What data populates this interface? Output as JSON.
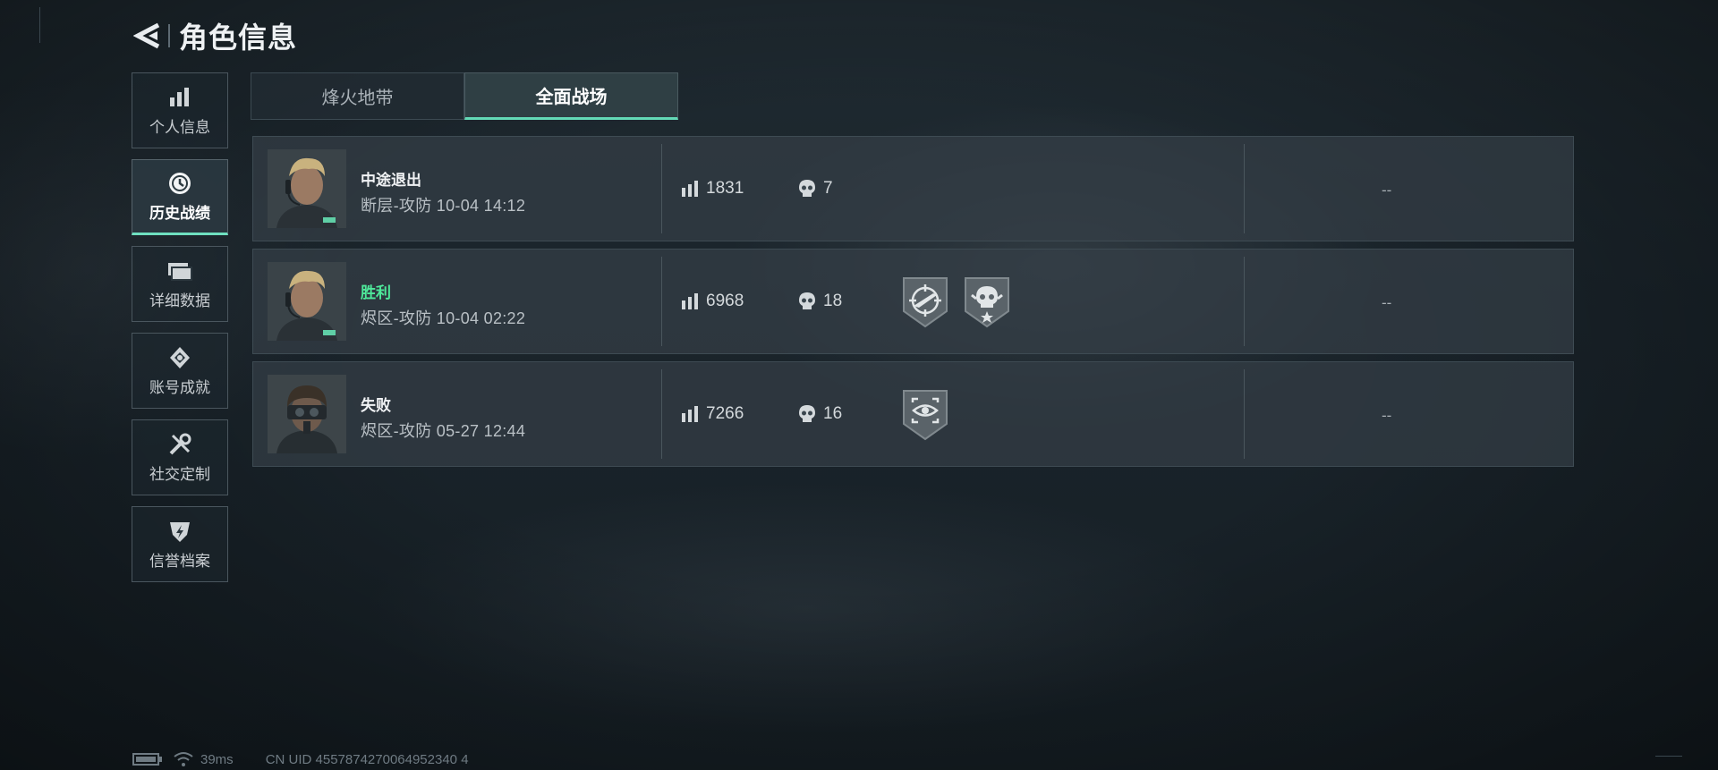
{
  "header": {
    "title": "角色信息"
  },
  "sidenav": {
    "items": [
      {
        "label": "个人信息",
        "icon": "bar-chart-icon"
      },
      {
        "label": "历史战绩",
        "icon": "clock-icon",
        "active": true
      },
      {
        "label": "详细数据",
        "icon": "cards-icon"
      },
      {
        "label": "账号成就",
        "icon": "achievement-icon"
      },
      {
        "label": "社交定制",
        "icon": "tools-icon"
      },
      {
        "label": "信誉档案",
        "icon": "shield-icon"
      }
    ]
  },
  "tabs": [
    {
      "label": "烽火地带",
      "active": false
    },
    {
      "label": "全面战场",
      "active": true
    }
  ],
  "matches": [
    {
      "result": "中途退出",
      "detail": "断层-攻防 10-04 14:12",
      "score": "1831",
      "kills": "7",
      "badges": [],
      "extra": "--"
    },
    {
      "result": "胜利",
      "detail": "烬区-攻防 10-04 02:22",
      "score": "6968",
      "kills": "18",
      "badges": [
        "rifle-target-badge-icon",
        "skull-star-badge-icon"
      ],
      "extra": "--"
    },
    {
      "result": "失败",
      "detail": "烬区-攻防 05-27 12:44",
      "score": "7266",
      "kills": "16",
      "badges": [
        "eye-scope-badge-icon"
      ],
      "extra": "--"
    }
  ],
  "footer": {
    "ping": "39ms",
    "uid": "CN UID 4557874270064952340 4"
  },
  "colors": {
    "accent": "#63d9b6",
    "win": "#4ee89a"
  }
}
